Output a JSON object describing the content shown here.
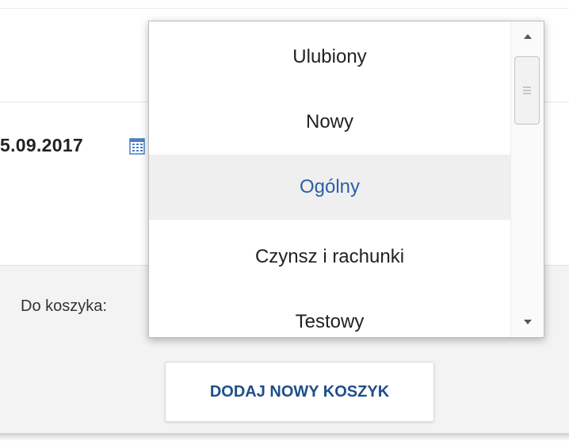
{
  "form": {
    "date_value": "5.09.2017",
    "cart_label": "Do koszyka:",
    "add_cart_button": "DODAJ NOWY KOSZYK"
  },
  "dropdown": {
    "options": [
      {
        "label": "Ulubiony"
      },
      {
        "label": "Nowy"
      },
      {
        "label": "Ogólny"
      },
      {
        "label": "Czynsz i rachunki"
      },
      {
        "label": "Testowy"
      }
    ],
    "selected": "Ogólny"
  },
  "colors": {
    "accent": "#1f4e8c",
    "selected_text": "#2b5ea8",
    "selected_bg": "#efefef",
    "calendar_icon": "#4a7fc1"
  },
  "icons": [
    "calendar-icon",
    "scroll-up-arrow-icon",
    "scroll-down-arrow-icon",
    "scroll-grip-icon"
  ]
}
